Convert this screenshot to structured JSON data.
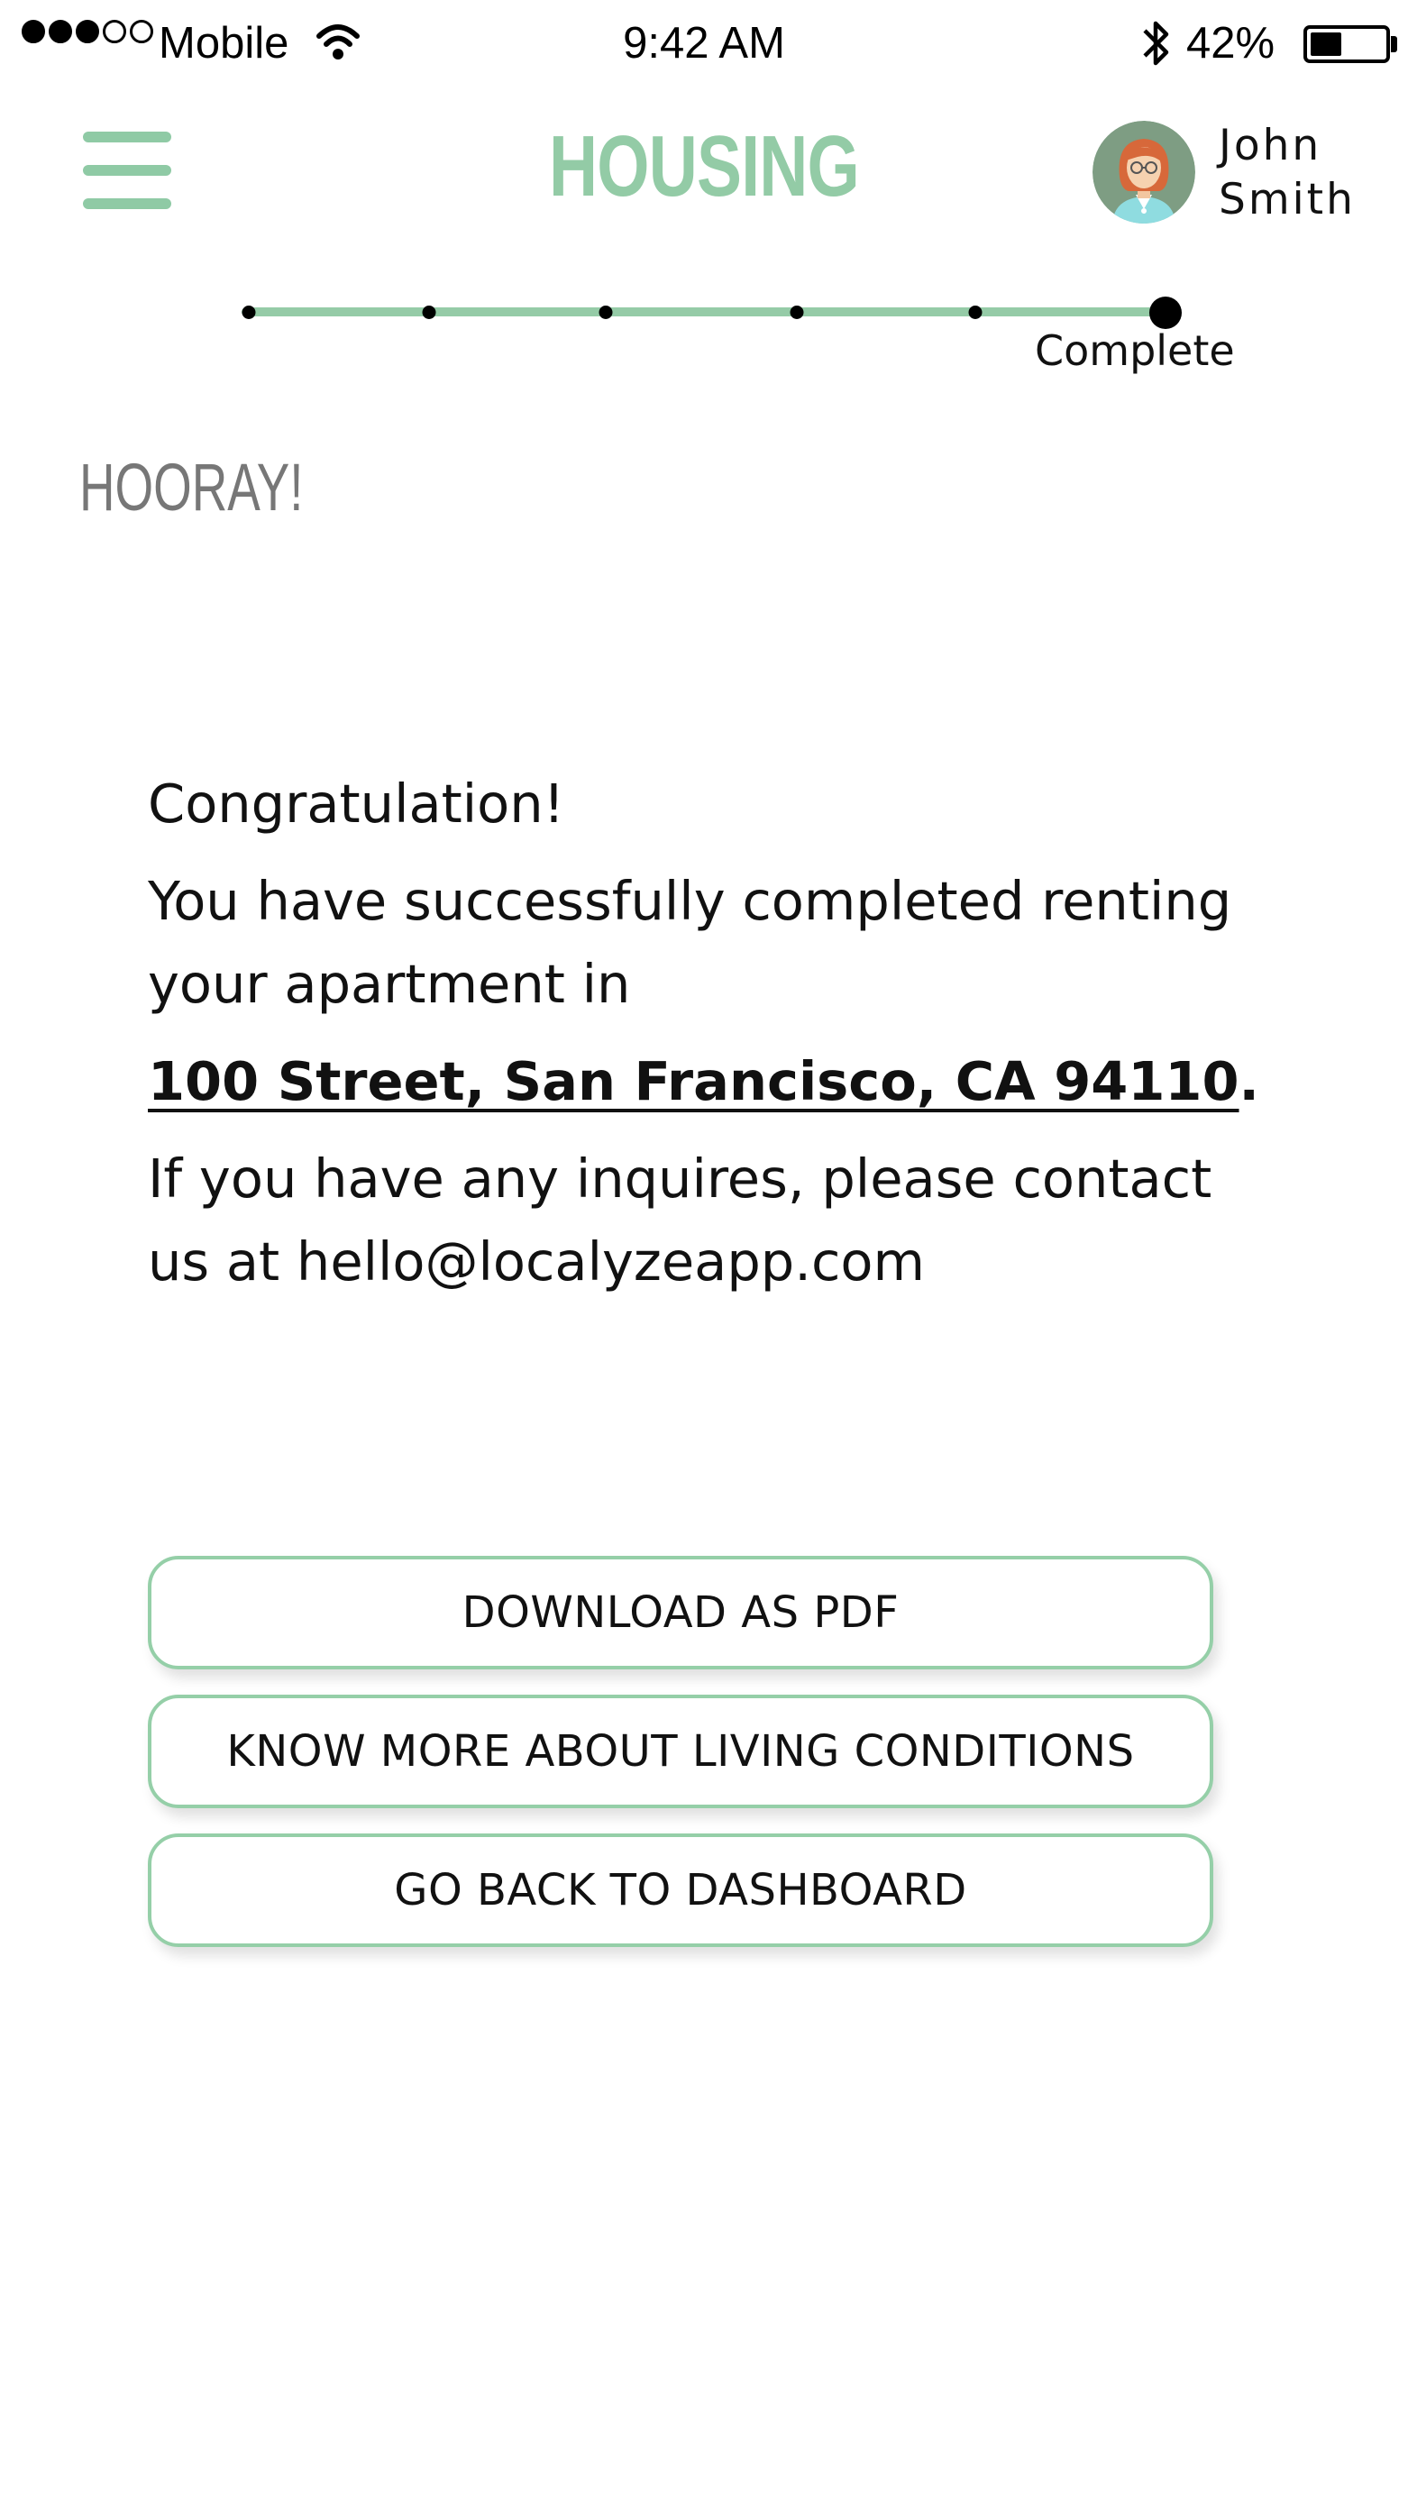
{
  "status_bar": {
    "carrier": "Mobile",
    "time": "9:42 AM",
    "battery_percent": "42%",
    "battery_level": 0.42,
    "signal_strength": 3,
    "signal_max": 5
  },
  "header": {
    "title": "HOUSING",
    "user_name": "John\nSmith",
    "accent_color": "#93cba6"
  },
  "progress": {
    "current_label": "Complete",
    "steps_total": 6,
    "current_step": 6
  },
  "section_heading": "HOORAY!",
  "message": {
    "greeting": "Congratulation!",
    "body": "You have successfully completed renting your apartment in",
    "address": "100 Street, San Francisco, CA 94110",
    "address_suffix": ".",
    "contact": "If you have any inquires, please contact us at hello@localyzeapp.com"
  },
  "actions": {
    "download_label": "DOWNLOAD AS PDF",
    "living_conditions_label": "KNOW MORE ABOUT LIVING CONDITIONS",
    "dashboard_label": "GO BACK TO DASHBOARD"
  },
  "icons": {
    "menu": "hamburger-menu-icon",
    "wifi": "wifi-icon",
    "bluetooth": "bluetooth-icon",
    "battery": "battery-icon",
    "avatar": "user-avatar"
  }
}
